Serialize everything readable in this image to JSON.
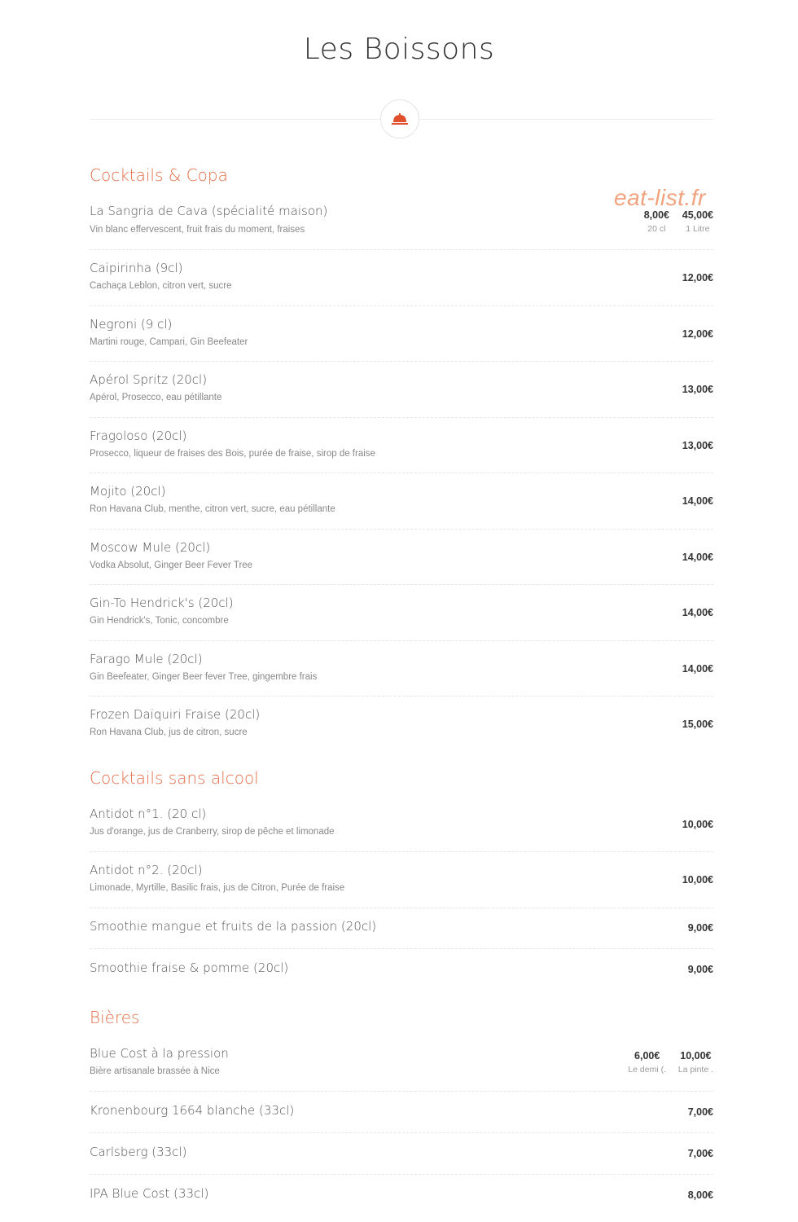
{
  "page": {
    "title": "Les Boissons"
  },
  "watermark": "eat-list.fr",
  "icons": {
    "divider": "serving-cloche-icon"
  },
  "colors": {
    "accent": "#e46f4a",
    "watermark": "#f1a27e"
  },
  "sections": [
    {
      "title": "Cocktails & Copa",
      "items": [
        {
          "name": "La Sangria de Cava (spécialité maison)",
          "desc": "Vin blanc effervescent, fruit frais du moment, fraises",
          "prices": [
            {
              "value": "8,00€",
              "unit": "20 cl"
            },
            {
              "value": "45,00€",
              "unit": "1 Litre"
            }
          ]
        },
        {
          "name": "Caïpirinha (9cl)",
          "desc": "Cachaça Leblon, citron vert, sucre",
          "price": "12,00€"
        },
        {
          "name": "Negroni (9 cl)",
          "desc": "Martini rouge, Campari, Gin Beefeater",
          "price": "12,00€"
        },
        {
          "name": "Apérol Spritz (20cl)",
          "desc": "Apérol, Prosecco, eau pétillante",
          "price": "13,00€"
        },
        {
          "name": "Fragoloso (20cl)",
          "desc": "Prosecco, liqueur de fraises des Bois, purée de fraise, sirop de fraise",
          "price": "13,00€"
        },
        {
          "name": "Mojito (20cl)",
          "desc": "Ron Havana Club, menthe, citron vert, sucre, eau pétillante",
          "price": "14,00€"
        },
        {
          "name": "Moscow Mule (20cl)",
          "desc": "Vodka Absolut, Ginger Beer Fever Tree",
          "price": "14,00€"
        },
        {
          "name": "Gin-To Hendrick's (20cl)",
          "desc": "Gin Hendrick's, Tonic, concombre",
          "price": "14,00€"
        },
        {
          "name": "Farago Mule (20cl)",
          "desc": "Gin Beefeater, Ginger Beer fever Tree, gingembre frais",
          "price": "14,00€"
        },
        {
          "name": "Frozen Daïquiri Fraise (20cl)",
          "desc": "Ron Havana Club, jus de citron, sucre",
          "price": "15,00€"
        }
      ]
    },
    {
      "title": "Cocktails sans alcool",
      "items": [
        {
          "name": "Antidot n°1. (20 cl)",
          "desc": "Jus d'orange, jus de Cranberry, sirop de pêche et limonade",
          "price": "10,00€"
        },
        {
          "name": "Antidot n°2. (20cl)",
          "desc": "Limonade, Myrtille, Basilic frais, jus de Citron, Purée de fraise",
          "price": "10,00€"
        },
        {
          "name": "Smoothie mangue et fruits de la passion (20cl)",
          "price": "9,00€"
        },
        {
          "name": "Smoothie fraise & pomme (20cl)",
          "price": "9,00€"
        }
      ]
    },
    {
      "title": "Bières",
      "items": [
        {
          "name": "Blue Cost à la pression",
          "desc": "Bière artisanale brassée à Nice",
          "prices": [
            {
              "value": "6,00€",
              "unit": "Le demi (."
            },
            {
              "value": "10,00€",
              "unit": "La pinte ."
            }
          ]
        },
        {
          "name": "Kronenbourg 1664 blanche (33cl)",
          "price": "7,00€"
        },
        {
          "name": "Carlsberg (33cl)",
          "price": "7,00€"
        },
        {
          "name": "IPA Blue Cost (33cl)",
          "price": "8,00€"
        }
      ]
    }
  ]
}
